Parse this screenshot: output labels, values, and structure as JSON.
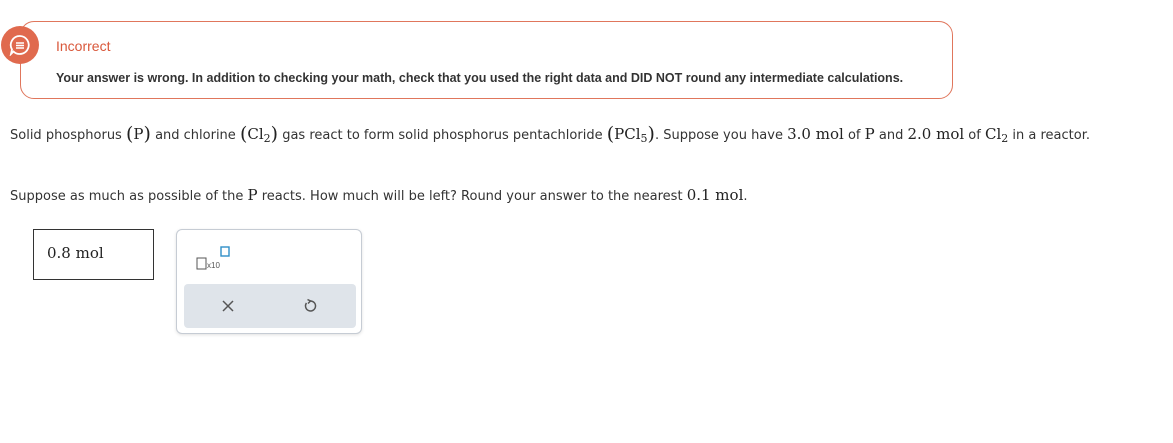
{
  "feedback": {
    "title": "Incorrect",
    "message": "Your answer is wrong. In addition to checking your math, check that you used the right data and DID NOT round any intermediate calculations."
  },
  "question": {
    "p1": {
      "t1": "Solid phosphorus",
      "m_P": "P",
      "t2": "and chlorine",
      "m_Cl": "Cl",
      "sub_2": "2",
      "t3": "gas react to form solid phosphorus pentachloride",
      "m_PCl": "PCl",
      "sub_5": "5",
      "t4": ". Suppose you have",
      "m_qty1": "3.0 mol",
      "t5": "of",
      "t6": "and",
      "m_qty2": "2.0 mol",
      "t7": "in a",
      "t8": "reactor."
    },
    "p2": {
      "t1": "Suppose as much as possible of the",
      "t2": "reacts. How much will be left? Round your answer to the nearest",
      "m_prec": "0.1 mol",
      "t3": "."
    }
  },
  "answer": {
    "value": "0.8 mol"
  },
  "tools": {
    "x10_label": "x10"
  },
  "colors": {
    "incorrect": "#e06a4e",
    "tool_bar": "#dfe4ea",
    "accent": "#2f8fc7"
  }
}
